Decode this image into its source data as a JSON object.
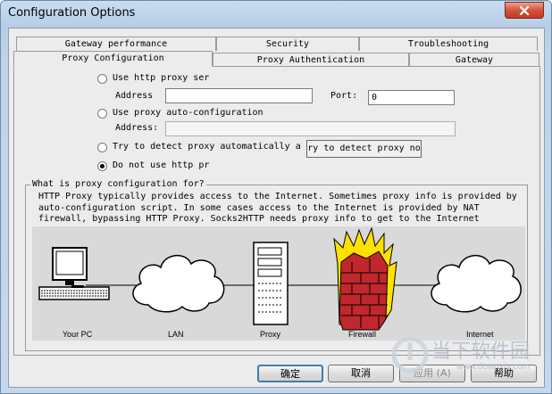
{
  "window": {
    "title": "Configuration Options"
  },
  "tabs": {
    "row1": [
      {
        "label": "Gateway performance"
      },
      {
        "label": "Security"
      },
      {
        "label": "Troubleshooting"
      }
    ],
    "row2": [
      {
        "label": "Proxy Configuration",
        "active": true
      },
      {
        "label": "Proxy Authentication"
      },
      {
        "label": "Gateway"
      }
    ]
  },
  "proxy": {
    "http_option_label": "Use http proxy ser",
    "address_label": "Address",
    "address_value": "",
    "port_label": "Port:",
    "port_value": "0",
    "auto_config_label": "Use proxy auto-configuration",
    "auto_address_label": "Address:",
    "auto_address_value": "",
    "detect_label": "Try to detect proxy automatically a",
    "detect_button_label": "ry to detect proxy no",
    "no_proxy_label": "Do not use http pr",
    "selected_option": "no_proxy"
  },
  "info": {
    "group_title": "What is proxy configuration for?",
    "lines": [
      "HTTP Proxy typically provides access to the Internet. Sometimes proxy info is provided by",
      "auto-configuration script. In some cases access to the Internet is provided by NAT",
      "firewall, bypassing HTTP Proxy. Socks2HTTP needs proxy info to get to the Internet"
    ]
  },
  "diagram": {
    "captions": [
      "Your PC",
      "LAN",
      "Proxy",
      "Firewall",
      "Internet"
    ]
  },
  "buttons": {
    "ok": "确定",
    "cancel": "取消",
    "apply": "应用 (A)",
    "help": "帮助"
  },
  "watermark": {
    "brand": "当下软件园",
    "url": "www.downxia.com"
  },
  "colors": {
    "firewall_brick": "#c0282d",
    "flame": "#ffe100",
    "close_button": "#c9452e"
  }
}
